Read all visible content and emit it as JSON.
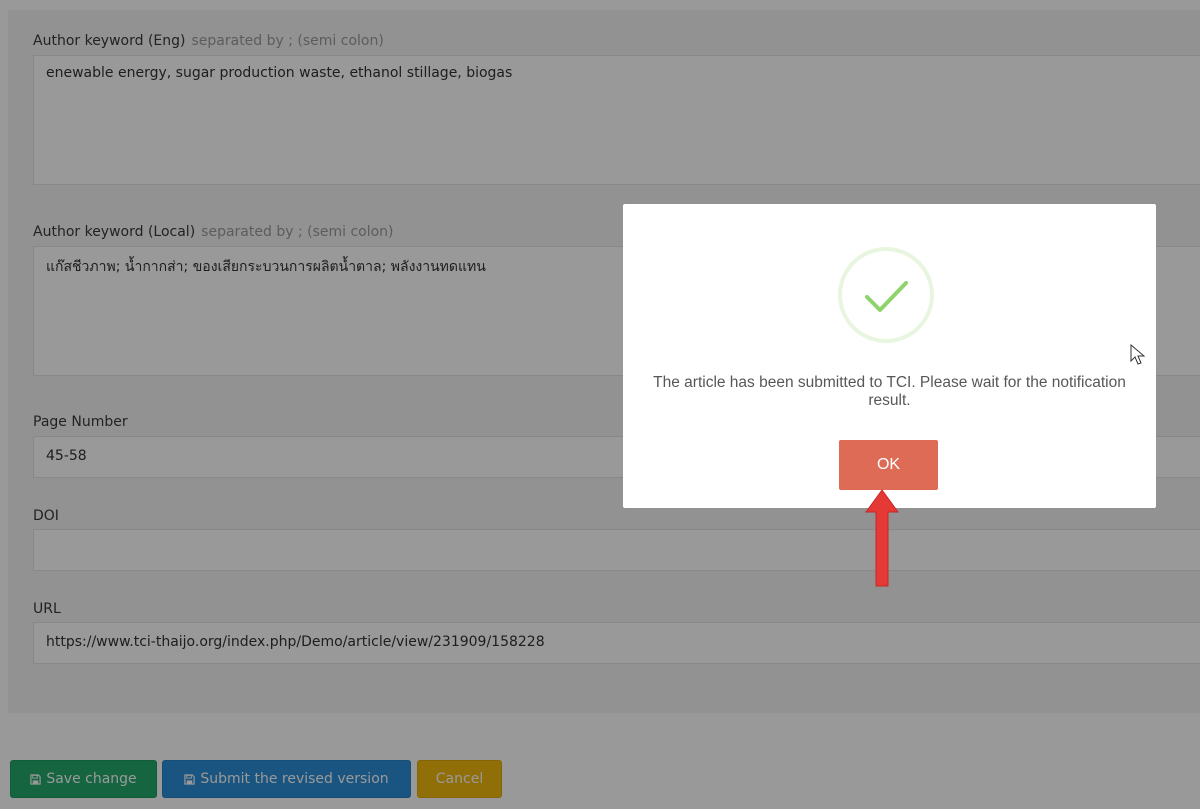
{
  "form": {
    "author_keyword_eng": {
      "label": "Author keyword (Eng)",
      "hint": "separated by ; (semi colon)",
      "value": "enewable energy, sugar production waste, ethanol stillage, biogas"
    },
    "author_keyword_local": {
      "label": "Author keyword (Local)",
      "hint": "separated by ; (semi colon)",
      "value": "แก๊สชีวภาพ; น้ำกากส่า; ของเสียกระบวนการผลิตน้ำตาล; พลังงานทดแทน"
    },
    "page_number": {
      "label": "Page Number",
      "value": "45-58"
    },
    "doi": {
      "label": "DOI",
      "value": ""
    },
    "url": {
      "label": "URL",
      "value": "https://www.tci-thaijo.org/index.php/Demo/article/view/231909/158228"
    }
  },
  "actions": {
    "save_label": "Save change",
    "submit_label": "Submit the revised version",
    "cancel_label": "Cancel",
    "save_icon": "floppy-disk-icon",
    "submit_icon": "floppy-disk-icon"
  },
  "modal": {
    "icon": "success-check-icon",
    "message": "The article has been submitted to TCI. Please wait for the notification result.",
    "ok_label": "OK"
  },
  "colors": {
    "save_button": "#22a86b",
    "submit_button": "#2a8ed6",
    "cancel_button": "#f0b90e",
    "ok_button": "#dd6b55",
    "success_check": "#8fd36c",
    "annotation_arrow": "#e53935"
  },
  "annotation": {
    "icon": "red-arrow-pointer-icon"
  }
}
